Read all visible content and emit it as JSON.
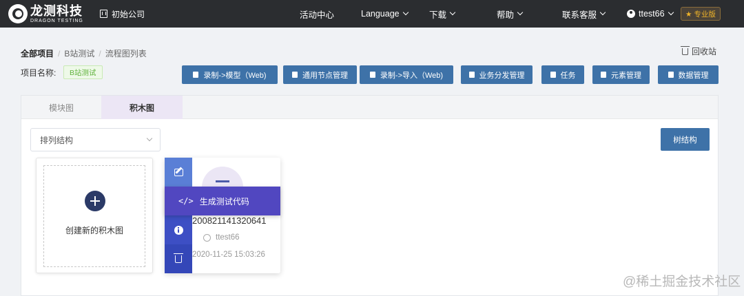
{
  "header": {
    "logo_cn": "龙测科技",
    "logo_en": "DRAGON TESTING",
    "company": "初始公司",
    "nav": [
      {
        "label": "活动中心",
        "has_dropdown": false
      },
      {
        "label": "Language",
        "has_dropdown": true
      },
      {
        "label": "下载",
        "has_dropdown": true
      },
      {
        "label": "帮助",
        "has_dropdown": true
      },
      {
        "label": "联系客服",
        "has_dropdown": true
      }
    ],
    "username": "ttest66",
    "pro_badge": "★ 专业版"
  },
  "breadcrumb": [
    "全部项目",
    "B站测试",
    "流程图列表"
  ],
  "recycle_bin": "回收站",
  "project": {
    "label": "项目名称:",
    "name": "B站测试"
  },
  "toolbar": [
    {
      "label": "录制->模型（Web)",
      "icon": "upload-icon"
    },
    {
      "label": "通用节点管理",
      "icon": "file-icon"
    },
    {
      "label": "录制->导入（Web)",
      "icon": "upload-icon"
    },
    {
      "label": "业务分发管理",
      "icon": "copy-icon"
    },
    {
      "label": "任务",
      "icon": "copy-icon"
    },
    {
      "label": "元素管理",
      "icon": "puzzle-icon"
    },
    {
      "label": "数据管理",
      "icon": "database-icon"
    }
  ],
  "tabs": [
    {
      "label": "模块图",
      "active": false
    },
    {
      "label": "积木图",
      "active": true
    }
  ],
  "sort_select": {
    "value": "排列结构"
  },
  "tree_button": "树结构",
  "create_card": {
    "label": "创建新的积木图"
  },
  "diagram_card": {
    "code": "200821141320641",
    "user": "ttest66",
    "time": "2020-11-25 15:03:26",
    "menu": {
      "generate_code": "生成测试代码"
    }
  },
  "watermark": "@稀土掘金技术社区",
  "colors": {
    "primary": "#3e72a8",
    "header_bg": "#2b2d30",
    "menu_purple": "#5147c0"
  }
}
